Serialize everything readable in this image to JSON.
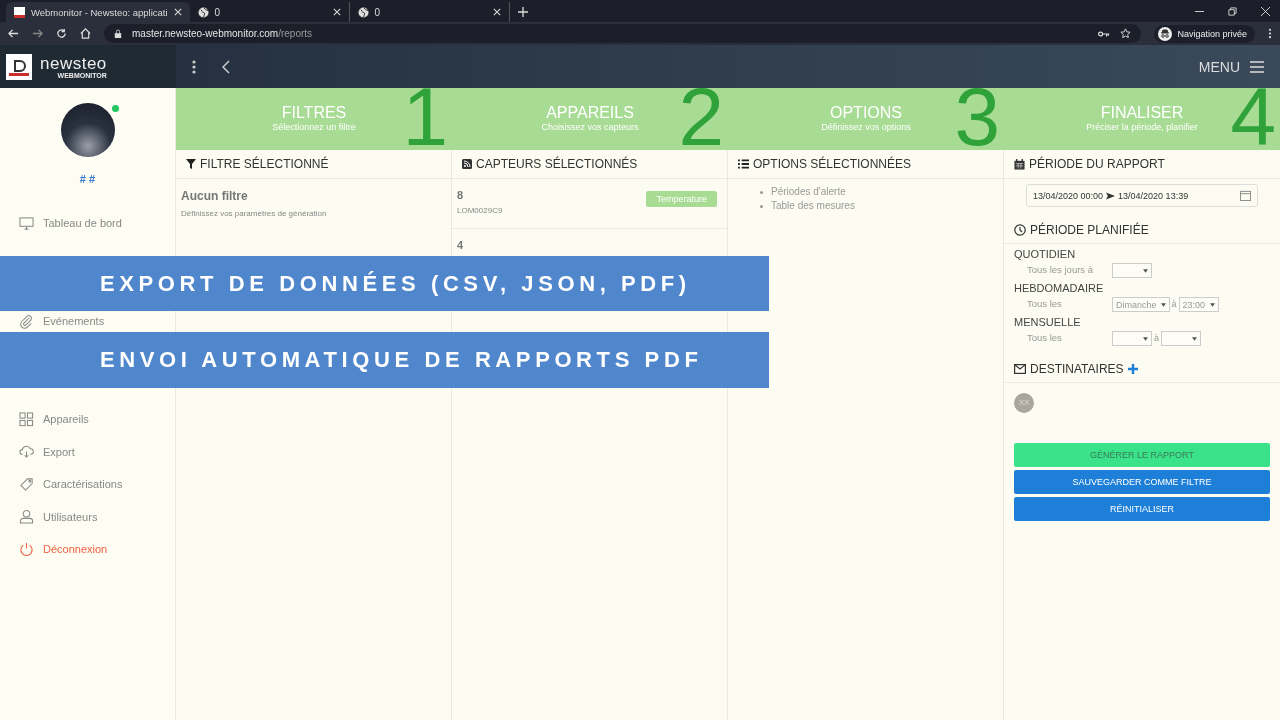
{
  "browser": {
    "tabs": [
      {
        "title": "Webmonitor - Newsteo: applicati",
        "selected": true
      },
      {
        "title": "0",
        "selected": false
      },
      {
        "title": "0",
        "selected": false
      }
    ],
    "url_host": "master.newsteo-webmonitor.com",
    "url_path": "/reports",
    "profile": "Navigation privée"
  },
  "app": {
    "logo": "newsteo",
    "logo_sub": "WEBMONITOR",
    "menu": "MENU"
  },
  "sidebar": {
    "user": "# #",
    "online": true,
    "groups": [
      [
        {
          "label": "Tableau de bord",
          "kind": "monitor"
        }
      ],
      [
        {
          "label": "Evénements",
          "kind": "paperclip"
        }
      ],
      [
        {
          "label": "Appareils",
          "kind": "grid"
        },
        {
          "label": "Export",
          "kind": "cloud"
        },
        {
          "label": "Caractérisations",
          "kind": "tag"
        },
        {
          "label": "Utilisateurs",
          "kind": "user"
        },
        {
          "label": "Déconnexion",
          "kind": "logout"
        }
      ]
    ]
  },
  "steps": [
    {
      "title": "FILTRES",
      "subtitle": "Sélectionnez un filtre",
      "number": "1"
    },
    {
      "title": "APPAREILS",
      "subtitle": "Choisissez vos capteurs",
      "number": "2"
    },
    {
      "title": "OPTIONS",
      "subtitle": "Définissez vos options",
      "number": "3"
    },
    {
      "title": "FINALISER",
      "subtitle": "Préciser la période, planifier",
      "number": "4"
    }
  ],
  "filter": {
    "heading": "FILTRE SÉLECTIONNÉ",
    "title": "Aucun filtre",
    "hint": "Définissez vos paramètres de génération"
  },
  "sensors": {
    "heading": "CAPTEURS SÉLECTIONNÉS",
    "items": [
      {
        "name": "8",
        "code": "LOM0029C9",
        "tag": "Temperature"
      },
      {
        "name": "4"
      }
    ]
  },
  "options": {
    "heading": "OPTIONS SÉLECTIONNÉES",
    "items": [
      "Périodes d'alerte",
      "Table des mesures"
    ]
  },
  "report": {
    "heading": "PÉRIODE DU RAPPORT",
    "range_start": "13/04/2020 00:00",
    "range_end": "13/04/2020 13:39",
    "schedule_heading": "PÉRIODE PLANIFIÉE",
    "schedules": [
      {
        "title": "QUOTIDIEN",
        "label": "Tous les jours à",
        "fields": [
          {
            "kind": "select"
          }
        ]
      },
      {
        "title": "HEBDOMADAIRE",
        "label": "Tous les",
        "fields": [
          {
            "kind": "select",
            "value": "Dimanche"
          },
          {
            "kind": "text",
            "value": "à"
          },
          {
            "kind": "select",
            "value": "23:00"
          }
        ]
      },
      {
        "title": "MENSUELLE",
        "label": "Tous les",
        "fields": [
          {
            "kind": "select"
          },
          {
            "kind": "text",
            "value": "à"
          },
          {
            "kind": "select"
          }
        ]
      }
    ],
    "recipients_heading": "DESTINATAIRES",
    "recipients": [
      "XX"
    ]
  },
  "buttons": [
    {
      "label": "GÉNÉRER LE RAPPORT",
      "kind": "success"
    },
    {
      "label": "SAUVEGARDER COMME FILTRE",
      "kind": "primary"
    },
    {
      "label": "RÉINITIALISER",
      "kind": "primary"
    }
  ],
  "banners": [
    "EXPORT DE DONNÉES (CSV, JSON, PDF)",
    "ENVOI AUTOMATIQUE DE RAPPORTS PDF"
  ]
}
